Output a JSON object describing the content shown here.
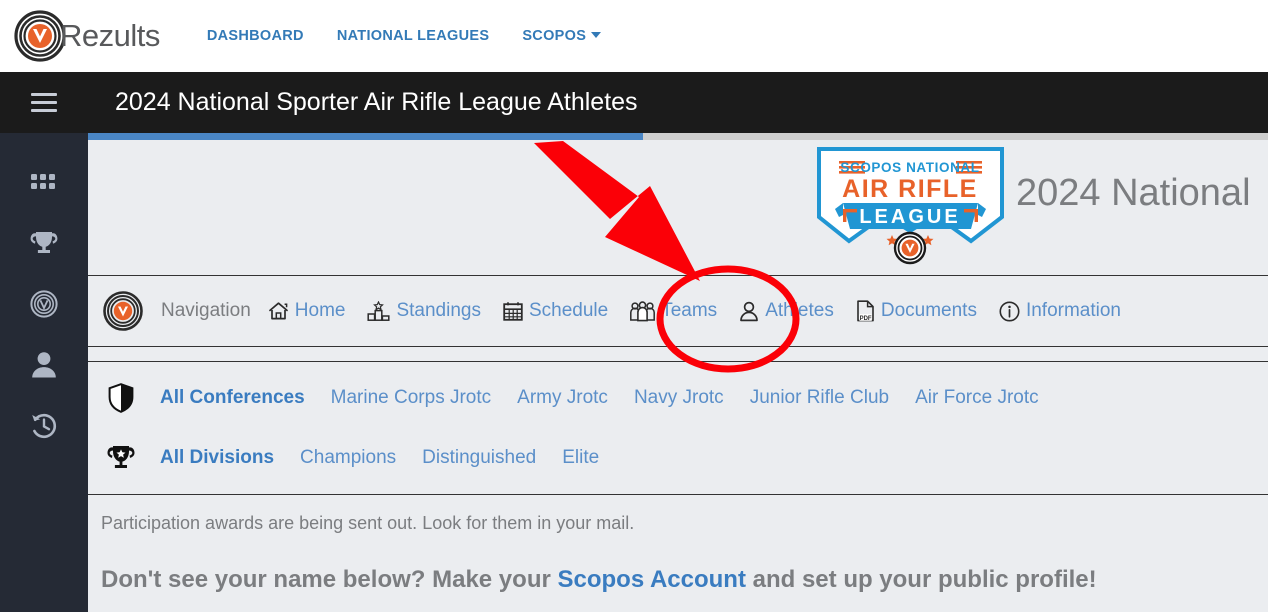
{
  "brand": {
    "name": "Rezults",
    "logo_icon": "target-bullseye-icon"
  },
  "topnav": {
    "items": [
      {
        "label": "DASHBOARD",
        "has_caret": false
      },
      {
        "label": "NATIONAL LEAGUES",
        "has_caret": false
      },
      {
        "label": "SCOPOS",
        "has_caret": true
      }
    ]
  },
  "sidebar": {
    "menu_icon": "hamburger-menu-icon",
    "items": [
      {
        "icon": "grid-apps-icon",
        "label": "Apps"
      },
      {
        "icon": "trophy-icon",
        "label": "Competitions"
      },
      {
        "icon": "target-bullseye-icon",
        "label": "Targets"
      },
      {
        "icon": "person-icon",
        "label": "Profile"
      },
      {
        "icon": "history-clock-icon",
        "label": "History"
      }
    ]
  },
  "header": {
    "title": "2024 National Sporter Air Rifle League Athletes",
    "progress_percent": 47
  },
  "banner": {
    "logo_lines": {
      "top": "SCOPOS NATIONAL",
      "middle": "AIR RIFLE",
      "ribbon": "LEAGUE"
    },
    "title": "2024 National"
  },
  "navigation": {
    "badge_icon": "target-bullseye-icon",
    "label": "Navigation",
    "links": [
      {
        "label": "Home",
        "icon": "home-icon"
      },
      {
        "label": "Standings",
        "icon": "podium-icon"
      },
      {
        "label": "Schedule",
        "icon": "calendar-icon"
      },
      {
        "label": "Teams",
        "icon": "people-group-icon"
      },
      {
        "label": "Athletes",
        "icon": "person-icon"
      },
      {
        "label": "Documents",
        "icon": "pdf-file-icon"
      },
      {
        "label": "Information",
        "icon": "info-circle-icon"
      }
    ]
  },
  "filters": {
    "conferences": {
      "icon": "shield-icon",
      "items": [
        {
          "label": "All Conferences",
          "active": true
        },
        {
          "label": "Marine Corps Jrotc",
          "active": false
        },
        {
          "label": "Army Jrotc",
          "active": false
        },
        {
          "label": "Navy Jrotc",
          "active": false
        },
        {
          "label": "Junior Rifle Club",
          "active": false
        },
        {
          "label": "Air Force Jrotc",
          "active": false
        }
      ]
    },
    "divisions": {
      "icon": "trophy-icon",
      "items": [
        {
          "label": "All Divisions",
          "active": true
        },
        {
          "label": "Champions",
          "active": false
        },
        {
          "label": "Distinguished",
          "active": false
        },
        {
          "label": "Elite",
          "active": false
        }
      ]
    }
  },
  "content": {
    "note1": "Participation awards are being sent out. Look for them in your mail.",
    "note2_prefix": "Don't see your name below? Make your ",
    "note2_link": "Scopos Account",
    "note2_suffix": " and set up your public profile!"
  },
  "annotations": {
    "arrow": {
      "name": "red-arrow-pointer",
      "color": "#fb0007"
    },
    "circle": {
      "name": "red-highlight-circle",
      "color": "#fb0007",
      "targets": "Athletes"
    }
  },
  "colors": {
    "accent_blue": "#337ab7",
    "link_blue": "#5b8fc9",
    "brand_orange": "#e8622a",
    "dark_header": "#1b1b1b",
    "sidebar_bg": "#252a35",
    "content_bg": "#ebedf0",
    "annotation_red": "#fb0007"
  }
}
